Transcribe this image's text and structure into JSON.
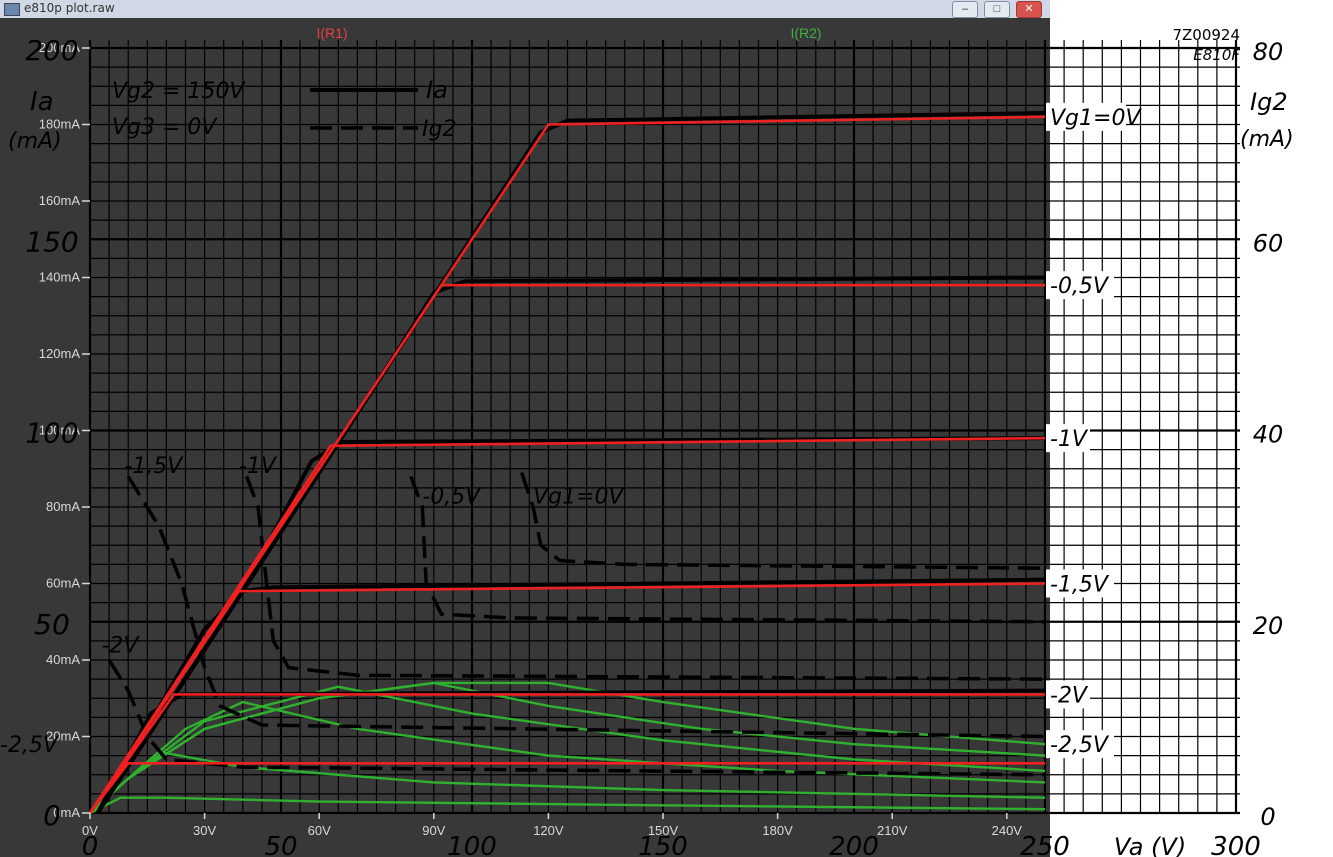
{
  "window": {
    "title": "e810p plot.raw",
    "min_glyph": "–",
    "max_glyph": "□",
    "close_glyph": "✕"
  },
  "chart_data": {
    "type": "line",
    "traces_header": [
      "I(R1)",
      "I(R2)"
    ],
    "colors": {
      "plot_bg": "#383838",
      "grid": "#000000",
      "ia_sim": "#ee2020",
      "ig2_sim": "#2fb02f",
      "ia_datasheet": "#000000",
      "header_r1": "#e84040",
      "header_r2": "#40b040",
      "axis_text": "#d8d8d8"
    },
    "x_axis": {
      "min": 0,
      "max": 250,
      "ticks": [
        0,
        30,
        60,
        90,
        120,
        150,
        180,
        210,
        240
      ],
      "tick_labels": [
        "0V",
        "30V",
        "60V",
        "90V",
        "120V",
        "150V",
        "180V",
        "210V",
        "240V"
      ]
    },
    "y_axis": {
      "min": 0,
      "max": 200,
      "ticks": [
        0,
        20,
        40,
        60,
        80,
        100,
        120,
        140,
        160,
        180,
        200
      ],
      "tick_labels": [
        "0mA",
        "20mA",
        "40mA",
        "60mA",
        "80mA",
        "100mA",
        "120mA",
        "140mA",
        "160mA",
        "180mA",
        "200mA"
      ]
    },
    "datasheet_overlay": {
      "code": "7Z00924",
      "tube": "E810F",
      "vg2_label": "Vg2 = 150V",
      "vg3_label": "Vg3 = 0V",
      "legend_ia": "Ia",
      "legend_ig2": "Ig2",
      "left_axis_title": "Ia",
      "left_axis_unit": "(mA)",
      "right_axis_title": "Ig2",
      "right_axis_unit": "(mA)",
      "x_axis_title": "Va (V)",
      "left_ticks": [
        {
          "value": 0,
          "label": "0"
        },
        {
          "value": 50,
          "label": "50"
        },
        {
          "value": 100,
          "label": "100"
        },
        {
          "value": 150,
          "label": "150"
        },
        {
          "value": 200,
          "label": "200"
        }
      ],
      "right_ticks": [
        {
          "ma": 0,
          "label": "0"
        },
        {
          "ma": 20,
          "label": "20"
        },
        {
          "ma": 40,
          "label": "40"
        },
        {
          "ma": 60,
          "label": "60"
        },
        {
          "ma": 80,
          "label": "80"
        }
      ],
      "bottom_ticks": [
        {
          "v": 0,
          "label": "0"
        },
        {
          "v": 50,
          "label": "50"
        },
        {
          "v": 100,
          "label": "100"
        },
        {
          "v": 150,
          "label": "150"
        },
        {
          "v": 200,
          "label": "200"
        },
        {
          "v": 250,
          "label": "250"
        },
        {
          "v": 300,
          "label": "300"
        }
      ],
      "ia_curve_labels": [
        {
          "label": "Vg1=0V",
          "ia": 182
        },
        {
          "label": "-0,5V",
          "ia": 138
        },
        {
          "label": "-1V",
          "ia": 98
        },
        {
          "label": "-1,5V",
          "ia": 60
        },
        {
          "label": "-2V",
          "ia": 31
        },
        {
          "label": "-2,5V",
          "ia": 18
        }
      ],
      "ig2_curve_labels": [
        {
          "label": "-1,5V",
          "va": 9,
          "ia": 91
        },
        {
          "label": "-1V",
          "va": 39,
          "ia": 91
        },
        {
          "label": "-0,5V",
          "va": 87,
          "ia": 83
        },
        {
          "label": "Vg1=0V",
          "va": 116,
          "ia": 83
        },
        {
          "label": "-2V",
          "va": 3,
          "ia": 44
        },
        {
          "label": "-2,5V",
          "va": -8,
          "ia": 18
        }
      ]
    },
    "ia_series": [
      {
        "vg1": 0,
        "knee": [
          120,
          180
        ],
        "end": [
          250,
          182
        ]
      },
      {
        "vg1": -0.5,
        "knee": [
          92,
          138
        ],
        "end": [
          250,
          138
        ]
      },
      {
        "vg1": -1,
        "knee": [
          63,
          96
        ],
        "end": [
          250,
          98
        ]
      },
      {
        "vg1": -1.5,
        "knee": [
          39,
          58
        ],
        "end": [
          250,
          60
        ]
      },
      {
        "vg1": -2,
        "knee": [
          22,
          31
        ],
        "end": [
          250,
          31
        ]
      },
      {
        "vg1": -2.5,
        "knee": [
          10,
          13
        ],
        "end": [
          250,
          13
        ]
      }
    ],
    "ig2_series": [
      {
        "vg1": 0,
        "points": [
          [
            0,
            0
          ],
          [
            10,
            9
          ],
          [
            30,
            22
          ],
          [
            60,
            30
          ],
          [
            90,
            34
          ],
          [
            120,
            34
          ],
          [
            150,
            29
          ],
          [
            200,
            22
          ],
          [
            250,
            18
          ]
        ]
      },
      {
        "vg1": -0.5,
        "points": [
          [
            0,
            0
          ],
          [
            10,
            9
          ],
          [
            30,
            22
          ],
          [
            60,
            30
          ],
          [
            90,
            34
          ],
          [
            120,
            28
          ],
          [
            160,
            22
          ],
          [
            200,
            18
          ],
          [
            250,
            15
          ]
        ]
      },
      {
        "vg1": -1,
        "points": [
          [
            0,
            0
          ],
          [
            10,
            9
          ],
          [
            30,
            24
          ],
          [
            65,
            33
          ],
          [
            100,
            26
          ],
          [
            150,
            19
          ],
          [
            200,
            14
          ],
          [
            250,
            11
          ]
        ]
      },
      {
        "vg1": -1.5,
        "points": [
          [
            0,
            0
          ],
          [
            10,
            9
          ],
          [
            25,
            22
          ],
          [
            40,
            29
          ],
          [
            70,
            22
          ],
          [
            120,
            15
          ],
          [
            180,
            11
          ],
          [
            250,
            8
          ]
        ]
      },
      {
        "vg1": -2,
        "points": [
          [
            0,
            0
          ],
          [
            10,
            9
          ],
          [
            18,
            16
          ],
          [
            40,
            12
          ],
          [
            90,
            8
          ],
          [
            150,
            6
          ],
          [
            250,
            4
          ]
        ]
      },
      {
        "vg1": -2.5,
        "points": [
          [
            0,
            0
          ],
          [
            8,
            4
          ],
          [
            20,
            4
          ],
          [
            60,
            3
          ],
          [
            150,
            2
          ],
          [
            250,
            1
          ]
        ]
      }
    ],
    "ia_datasheet_series": [
      {
        "vg1": 0,
        "points": [
          [
            2,
            0
          ],
          [
            40,
            58
          ],
          [
            80,
            120
          ],
          [
            118,
            178
          ],
          [
            125,
            181
          ],
          [
            250,
            183
          ]
        ]
      },
      {
        "vg1": -0.5,
        "points": [
          [
            2,
            0
          ],
          [
            40,
            58
          ],
          [
            80,
            120
          ],
          [
            90,
            136
          ],
          [
            98,
            139
          ],
          [
            250,
            140
          ]
        ]
      },
      {
        "vg1": -1,
        "points": [
          [
            2,
            0
          ],
          [
            40,
            58
          ],
          [
            58,
            92
          ],
          [
            66,
            97
          ],
          [
            250,
            98
          ]
        ]
      },
      {
        "vg1": -1.5,
        "points": [
          [
            2,
            0
          ],
          [
            30,
            48
          ],
          [
            40,
            58
          ],
          [
            48,
            59
          ],
          [
            250,
            61
          ]
        ]
      },
      {
        "vg1": -2,
        "points": [
          [
            2,
            0
          ],
          [
            16,
            26
          ],
          [
            24,
            31
          ],
          [
            250,
            32
          ]
        ]
      }
    ],
    "ig2_datasheet_series": [
      {
        "vg1": 0,
        "points": [
          [
            113,
            89
          ],
          [
            116,
            80
          ],
          [
            118,
            70
          ],
          [
            123,
            66
          ],
          [
            140,
            65
          ],
          [
            250,
            64
          ]
        ]
      },
      {
        "vg1": -0.5,
        "points": [
          [
            84,
            88
          ],
          [
            87,
            80
          ],
          [
            88,
            60
          ],
          [
            92,
            52
          ],
          [
            110,
            51
          ],
          [
            250,
            50
          ]
        ]
      },
      {
        "vg1": -1,
        "points": [
          [
            41,
            88
          ],
          [
            44,
            80
          ],
          [
            46,
            62
          ],
          [
            48,
            45
          ],
          [
            52,
            38
          ],
          [
            70,
            36
          ],
          [
            250,
            35
          ]
        ]
      },
      {
        "vg1": -1.5,
        "points": [
          [
            10,
            88
          ],
          [
            18,
            75
          ],
          [
            24,
            60
          ],
          [
            30,
            38
          ],
          [
            34,
            28
          ],
          [
            45,
            23
          ],
          [
            250,
            20
          ]
        ]
      },
      {
        "vg1": -2,
        "points": [
          [
            5,
            40
          ],
          [
            10,
            32
          ],
          [
            15,
            20
          ],
          [
            20,
            14
          ],
          [
            40,
            12
          ],
          [
            250,
            10
          ]
        ]
      }
    ]
  }
}
